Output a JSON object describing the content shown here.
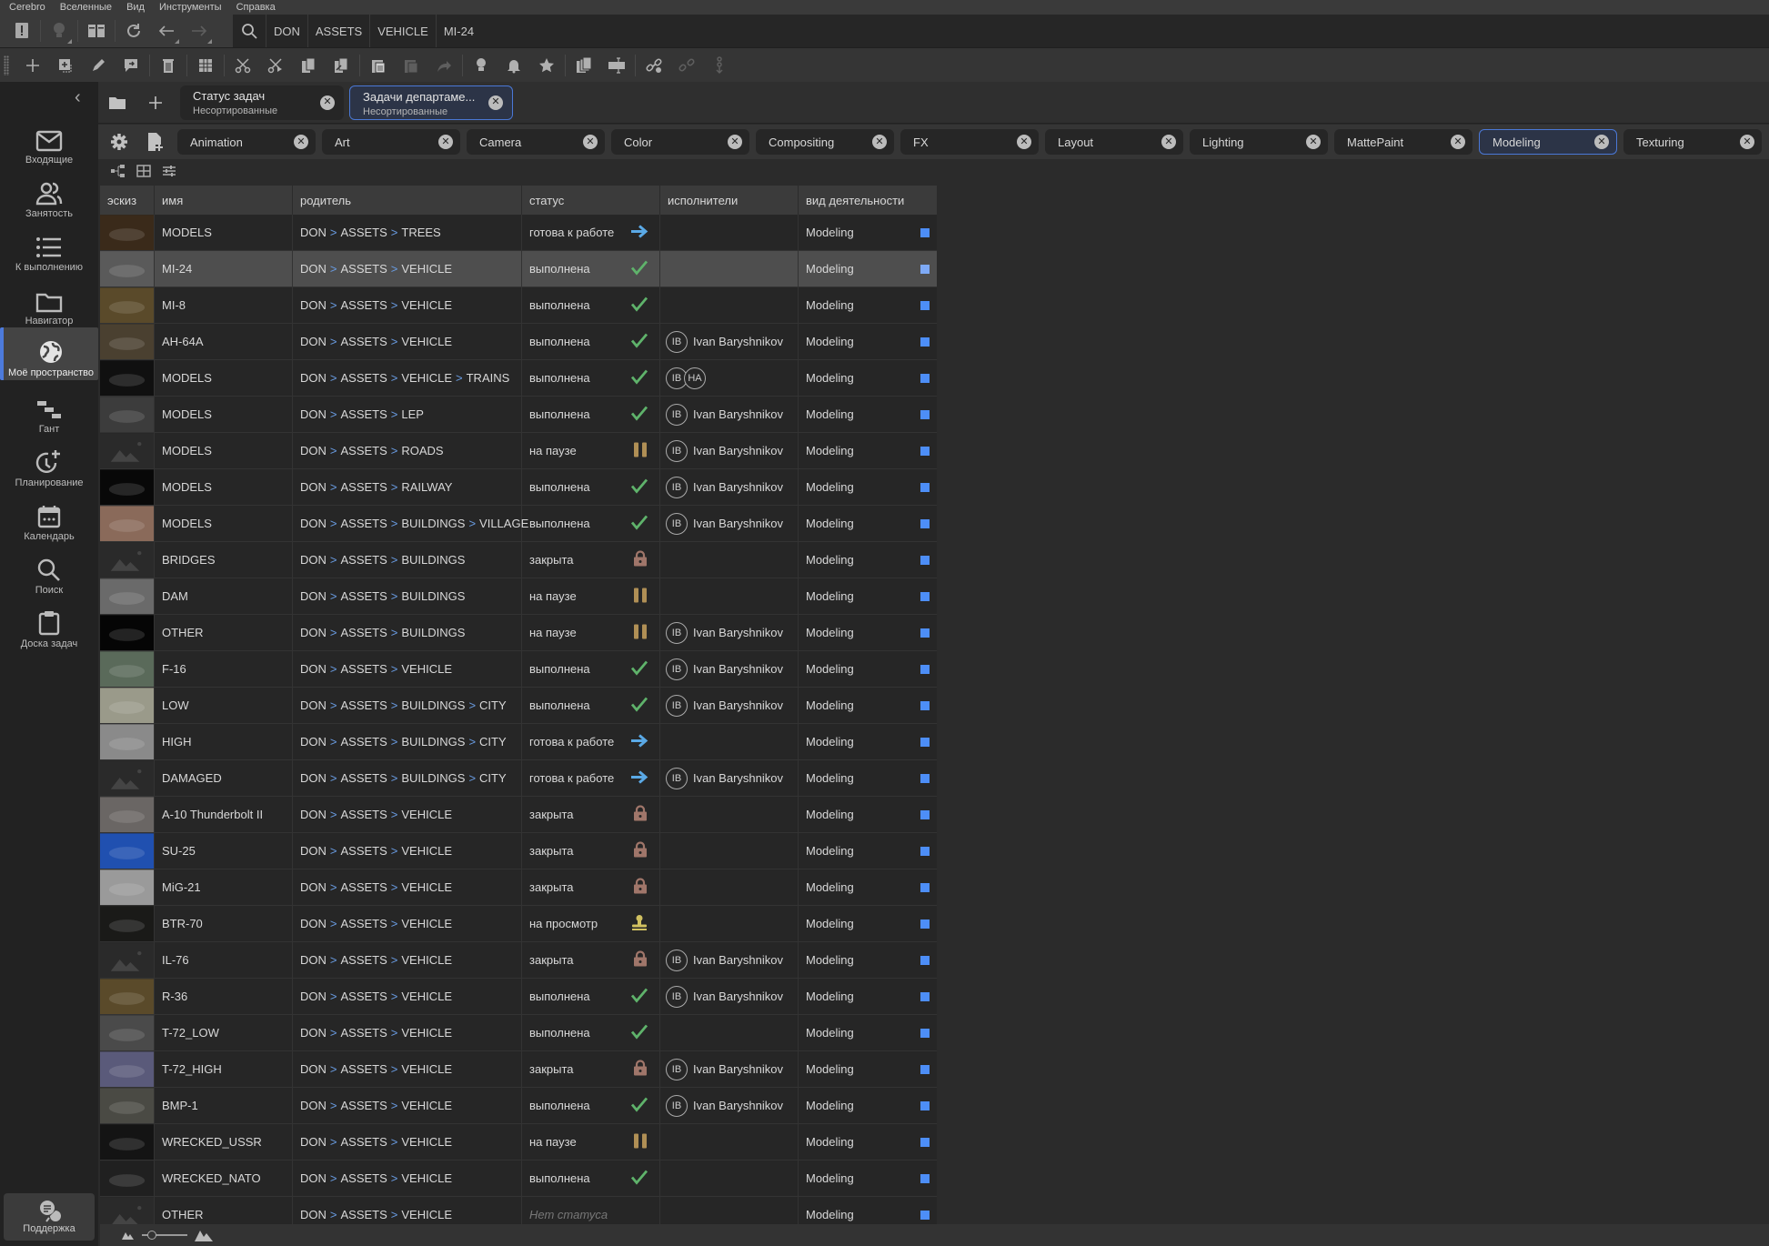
{
  "menu": [
    "Cerebro",
    "Вселенные",
    "Вид",
    "Инструменты",
    "Справка"
  ],
  "navbar": {
    "icons": [
      "todo-icon",
      "lightbulb-icon",
      "book-icon",
      "refresh-icon",
      "back-arrow-icon",
      "forward-arrow-icon",
      "search-icon"
    ],
    "breadcrumb": [
      "DON",
      "ASSETS",
      "VEHICLE",
      "MI-24"
    ]
  },
  "toolbar": {
    "icons": [
      "add-icon",
      "add-subtask-icon",
      "edit-icon",
      "message-icon",
      "delete-icon",
      "archive-icon",
      "cut-icon",
      "cut-link-icon",
      "copy-icon",
      "copy-link-icon",
      "paste-icon",
      "paste-special-icon",
      "share-icon",
      "lightbulb-icon",
      "bell-icon",
      "star-icon",
      "duplicate-icon",
      "resize-icon",
      "link-icon",
      "unlink-icon",
      "chain-icon"
    ]
  },
  "sidebar": {
    "items": [
      {
        "label": "Входящие",
        "icon": "mail-icon"
      },
      {
        "label": "Занятость",
        "icon": "users-icon"
      },
      {
        "label": "К выполнению",
        "icon": "list-icon"
      },
      {
        "label": "Навигатор",
        "icon": "folder-icon"
      },
      {
        "label": "Моё пространство",
        "icon": "globe-icon",
        "active": true
      },
      {
        "label": "Гант",
        "icon": "gantt-icon"
      },
      {
        "label": "Планирование",
        "icon": "clock-plus-icon"
      },
      {
        "label": "Календарь",
        "icon": "calendar-icon"
      },
      {
        "label": "Поиск",
        "icon": "search-icon"
      },
      {
        "label": "Доска задач",
        "icon": "clipboard-icon"
      }
    ],
    "support": "Поддержка"
  },
  "tabs": [
    {
      "title": "Статус задач",
      "subtitle": "Несортированные",
      "active": false
    },
    {
      "title": "Задачи департаме...",
      "subtitle": "Несортированные",
      "active": true
    }
  ],
  "filters": [
    {
      "label": "Animation",
      "active": false
    },
    {
      "label": "Art",
      "active": false
    },
    {
      "label": "Camera",
      "active": false
    },
    {
      "label": "Color",
      "active": false
    },
    {
      "label": "Compositing",
      "active": false
    },
    {
      "label": "FX",
      "active": false
    },
    {
      "label": "Layout",
      "active": false
    },
    {
      "label": "Lighting",
      "active": false
    },
    {
      "label": "MattePaint",
      "active": false
    },
    {
      "label": "Modeling",
      "active": true
    },
    {
      "label": "Texturing",
      "active": false
    }
  ],
  "table": {
    "headers": [
      "эскиз",
      "имя",
      "родитель",
      "статус",
      "исполнители",
      "вид деятельности"
    ],
    "rows": [
      {
        "thumb": "#3a2a1a",
        "name": "MODELS",
        "parent": [
          "DON",
          "ASSETS",
          "TREES"
        ],
        "status": "готова к работе",
        "st": "ready",
        "assignees": [],
        "assignee_name": "",
        "activity": "Modeling"
      },
      {
        "thumb": "#5a5a5a",
        "name": "MI-24",
        "parent": [
          "DON",
          "ASSETS",
          "VEHICLE"
        ],
        "status": "выполнена",
        "st": "done",
        "assignees": [],
        "assignee_name": "",
        "activity": "Modeling",
        "selected": true
      },
      {
        "thumb": "#5a4a2a",
        "name": "MI-8",
        "parent": [
          "DON",
          "ASSETS",
          "VEHICLE"
        ],
        "status": "выполнена",
        "st": "done",
        "assignees": [],
        "assignee_name": "",
        "activity": "Modeling"
      },
      {
        "thumb": "#4a4030",
        "name": "AH-64A",
        "parent": [
          "DON",
          "ASSETS",
          "VEHICLE"
        ],
        "status": "выполнена",
        "st": "done",
        "assignees": [
          "IB"
        ],
        "assignee_name": "Ivan Baryshnikov",
        "activity": "Modeling"
      },
      {
        "thumb": "#101010",
        "name": "MODELS",
        "parent": [
          "DON",
          "ASSETS",
          "VEHICLE",
          "TRAINS"
        ],
        "status": "выполнена",
        "st": "done",
        "assignees": [
          "IB",
          "HA"
        ],
        "assignee_name": "",
        "activity": "Modeling"
      },
      {
        "thumb": "#3c3c3c",
        "name": "MODELS",
        "parent": [
          "DON",
          "ASSETS",
          "LEP"
        ],
        "status": "выполнена",
        "st": "done",
        "assignees": [
          "IB"
        ],
        "assignee_name": "Ivan Baryshnikov",
        "activity": "Modeling"
      },
      {
        "thumb": "placeholder",
        "name": "MODELS",
        "parent": [
          "DON",
          "ASSETS",
          "ROADS"
        ],
        "status": "на паузе",
        "st": "paused",
        "assignees": [
          "IB"
        ],
        "assignee_name": "Ivan Baryshnikov",
        "activity": "Modeling"
      },
      {
        "thumb": "#080808",
        "name": "MODELS",
        "parent": [
          "DON",
          "ASSETS",
          "RAILWAY"
        ],
        "status": "выполнена",
        "st": "done",
        "assignees": [
          "IB"
        ],
        "assignee_name": "Ivan Baryshnikov",
        "activity": "Modeling"
      },
      {
        "thumb": "#8a6a5a",
        "name": "MODELS",
        "parent": [
          "DON",
          "ASSETS",
          "BUILDINGS",
          "VILLAGE"
        ],
        "status": "выполнена",
        "st": "done",
        "assignees": [
          "IB"
        ],
        "assignee_name": "Ivan Baryshnikov",
        "activity": "Modeling"
      },
      {
        "thumb": "placeholder",
        "name": "BRIDGES",
        "parent": [
          "DON",
          "ASSETS",
          "BUILDINGS"
        ],
        "status": "закрыта",
        "st": "closed",
        "assignees": [],
        "assignee_name": "",
        "activity": "Modeling"
      },
      {
        "thumb": "#6a6a6a",
        "name": "DAM",
        "parent": [
          "DON",
          "ASSETS",
          "BUILDINGS"
        ],
        "status": "на паузе",
        "st": "paused",
        "assignees": [],
        "assignee_name": "",
        "activity": "Modeling"
      },
      {
        "thumb": "#050505",
        "name": "OTHER",
        "parent": [
          "DON",
          "ASSETS",
          "BUILDINGS"
        ],
        "status": "на паузе",
        "st": "paused",
        "assignees": [
          "IB"
        ],
        "assignee_name": "Ivan Baryshnikov",
        "activity": "Modeling"
      },
      {
        "thumb": "#5a6a5a",
        "name": "F-16",
        "parent": [
          "DON",
          "ASSETS",
          "VEHICLE"
        ],
        "status": "выполнена",
        "st": "done",
        "assignees": [
          "IB"
        ],
        "assignee_name": "Ivan Baryshnikov",
        "activity": "Modeling"
      },
      {
        "thumb": "#9a9a8a",
        "name": "LOW",
        "parent": [
          "DON",
          "ASSETS",
          "BUILDINGS",
          "CITY"
        ],
        "status": "выполнена",
        "st": "done",
        "assignees": [
          "IB"
        ],
        "assignee_name": "Ivan Baryshnikov",
        "activity": "Modeling"
      },
      {
        "thumb": "#8a8a8a",
        "name": "HIGH",
        "parent": [
          "DON",
          "ASSETS",
          "BUILDINGS",
          "CITY"
        ],
        "status": "готова к работе",
        "st": "ready",
        "assignees": [],
        "assignee_name": "",
        "activity": "Modeling"
      },
      {
        "thumb": "placeholder",
        "name": "DAMAGED",
        "parent": [
          "DON",
          "ASSETS",
          "BUILDINGS",
          "CITY"
        ],
        "status": "готова к работе",
        "st": "ready",
        "assignees": [
          "IB"
        ],
        "assignee_name": "Ivan Baryshnikov",
        "activity": "Modeling"
      },
      {
        "thumb": "#6a6664",
        "name": "A-10 Thunderbolt II",
        "parent": [
          "DON",
          "ASSETS",
          "VEHICLE"
        ],
        "status": "закрыта",
        "st": "closed",
        "assignees": [],
        "assignee_name": "",
        "activity": "Modeling"
      },
      {
        "thumb": "#2050b0",
        "name": "SU-25",
        "parent": [
          "DON",
          "ASSETS",
          "VEHICLE"
        ],
        "status": "закрыта",
        "st": "closed",
        "assignees": [],
        "assignee_name": "",
        "activity": "Modeling"
      },
      {
        "thumb": "#9a9a9a",
        "name": "MiG-21",
        "parent": [
          "DON",
          "ASSETS",
          "VEHICLE"
        ],
        "status": "закрыта",
        "st": "closed",
        "assignees": [],
        "assignee_name": "",
        "activity": "Modeling"
      },
      {
        "thumb": "#1a1a18",
        "name": "BTR-70",
        "parent": [
          "DON",
          "ASSETS",
          "VEHICLE"
        ],
        "status": "на просмотр",
        "st": "review",
        "assignees": [],
        "assignee_name": "",
        "activity": "Modeling"
      },
      {
        "thumb": "placeholder",
        "name": "IL-76",
        "parent": [
          "DON",
          "ASSETS",
          "VEHICLE"
        ],
        "status": "закрыта",
        "st": "closed",
        "assignees": [
          "IB"
        ],
        "assignee_name": "Ivan Baryshnikov",
        "activity": "Modeling"
      },
      {
        "thumb": "#5a4a2a",
        "name": "R-36",
        "parent": [
          "DON",
          "ASSETS",
          "VEHICLE"
        ],
        "status": "выполнена",
        "st": "done",
        "assignees": [
          "IB"
        ],
        "assignee_name": "Ivan Baryshnikov",
        "activity": "Modeling"
      },
      {
        "thumb": "#4a4a4a",
        "name": "T-72_LOW",
        "parent": [
          "DON",
          "ASSETS",
          "VEHICLE"
        ],
        "status": "выполнена",
        "st": "done",
        "assignees": [],
        "assignee_name": "",
        "activity": "Modeling"
      },
      {
        "thumb": "#5a5a7a",
        "name": "T-72_HIGH",
        "parent": [
          "DON",
          "ASSETS",
          "VEHICLE"
        ],
        "status": "закрыта",
        "st": "closed",
        "assignees": [
          "IB"
        ],
        "assignee_name": "Ivan Baryshnikov",
        "activity": "Modeling"
      },
      {
        "thumb": "#4a4a44",
        "name": "BMP-1",
        "parent": [
          "DON",
          "ASSETS",
          "VEHICLE"
        ],
        "status": "выполнена",
        "st": "done",
        "assignees": [
          "IB"
        ],
        "assignee_name": "Ivan Baryshnikov",
        "activity": "Modeling"
      },
      {
        "thumb": "#141414",
        "name": "WRECKED_USSR",
        "parent": [
          "DON",
          "ASSETS",
          "VEHICLE"
        ],
        "status": "на паузе",
        "st": "paused",
        "assignees": [],
        "assignee_name": "",
        "activity": "Modeling"
      },
      {
        "thumb": "#202020",
        "name": "WRECKED_NATO",
        "parent": [
          "DON",
          "ASSETS",
          "VEHICLE"
        ],
        "status": "выполнена",
        "st": "done",
        "assignees": [],
        "assignee_name": "",
        "activity": "Modeling"
      },
      {
        "thumb": "placeholder",
        "name": "OTHER",
        "parent": [
          "DON",
          "ASSETS",
          "VEHICLE"
        ],
        "status": "Нет статуса",
        "st": "none",
        "assignees": [],
        "assignee_name": "",
        "activity": "Modeling"
      }
    ]
  },
  "colors": {
    "accent": "#4a78d6",
    "ready": "#5aa9e6",
    "done": "#5fb36b",
    "paused": "#b08f55",
    "closed": "#a0766a",
    "review": "#d0c060",
    "activity": "#4d8ef7",
    "breadcrumb_sep": "#6a9de4"
  }
}
